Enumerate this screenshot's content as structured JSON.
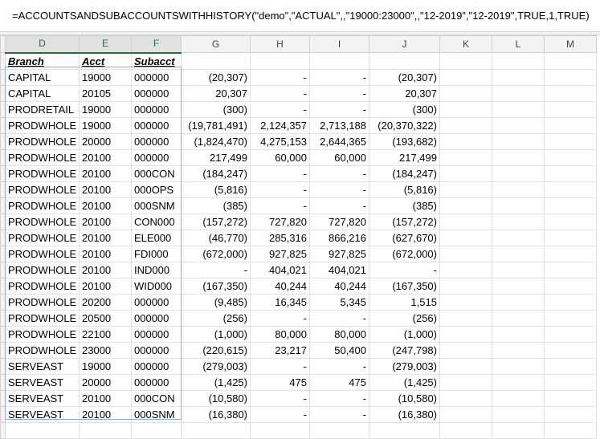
{
  "formula": "=ACCOUNTSANDSUBACCOUNTSWITHHISTORY(\"demo\",\"ACTUAL\",,\"19000:23000\",,\"12-2019\",\"12-2019\",TRUE,1,TRUE)",
  "columns": [
    "D",
    "E",
    "F",
    "G",
    "H",
    "I",
    "J",
    "K",
    "L",
    "M"
  ],
  "headers": [
    "Branch",
    "Acct",
    "Subacct"
  ],
  "rows": [
    [
      "CAPITAL",
      "19000",
      "000000",
      "(20,307)",
      "-",
      "-",
      "(20,307)"
    ],
    [
      "CAPITAL",
      "20105",
      "000000",
      "20,307",
      "-",
      "-",
      "20,307"
    ],
    [
      "PRODRETAIL",
      "19000",
      "000000",
      "(300)",
      "-",
      "-",
      "(300)"
    ],
    [
      "PRODWHOLE",
      "19000",
      "000000",
      "(19,781,491)",
      "2,124,357",
      "2,713,188",
      "(20,370,322)"
    ],
    [
      "PRODWHOLE",
      "20000",
      "000000",
      "(1,824,470)",
      "4,275,153",
      "2,644,365",
      "(193,682)"
    ],
    [
      "PRODWHOLE",
      "20100",
      "000000",
      "217,499",
      "60,000",
      "60,000",
      "217,499"
    ],
    [
      "PRODWHOLE",
      "20100",
      "000CON",
      "(184,247)",
      "-",
      "-",
      "(184,247)"
    ],
    [
      "PRODWHOLE",
      "20100",
      "000OPS",
      "(5,816)",
      "-",
      "-",
      "(5,816)"
    ],
    [
      "PRODWHOLE",
      "20100",
      "000SNM",
      "(385)",
      "-",
      "-",
      "(385)"
    ],
    [
      "PRODWHOLE",
      "20100",
      "CON000",
      "(157,272)",
      "727,820",
      "727,820",
      "(157,272)"
    ],
    [
      "PRODWHOLE",
      "20100",
      "ELE000",
      "(46,770)",
      "285,316",
      "866,216",
      "(627,670)"
    ],
    [
      "PRODWHOLE",
      "20100",
      "FDI000",
      "(672,000)",
      "927,825",
      "927,825",
      "(672,000)"
    ],
    [
      "PRODWHOLE",
      "20100",
      "IND000",
      "-",
      "404,021",
      "404,021",
      "-"
    ],
    [
      "PRODWHOLE",
      "20100",
      "WID000",
      "(167,350)",
      "40,244",
      "40,244",
      "(167,350)"
    ],
    [
      "PRODWHOLE",
      "20200",
      "000000",
      "(9,485)",
      "16,345",
      "5,345",
      "1,515"
    ],
    [
      "PRODWHOLE",
      "20500",
      "000000",
      "(256)",
      "-",
      "-",
      "(256)"
    ],
    [
      "PRODWHOLE",
      "22100",
      "000000",
      "(1,000)",
      "80,000",
      "80,000",
      "(1,000)"
    ],
    [
      "PRODWHOLE",
      "23000",
      "000000",
      "(220,615)",
      "23,217",
      "50,400",
      "(247,798)"
    ],
    [
      "SERVEAST",
      "19000",
      "000000",
      "(279,003)",
      "-",
      "-",
      "(279,003)"
    ],
    [
      "SERVEAST",
      "20000",
      "000000",
      "(1,425)",
      "475",
      "475",
      "(1,425)"
    ],
    [
      "SERVEAST",
      "20100",
      "000CON",
      "(10,580)",
      "-",
      "-",
      "(10,580)"
    ],
    [
      "SERVEAST",
      "20100",
      "000SNM",
      "(16,380)",
      "-",
      "-",
      "(16,380)"
    ]
  ]
}
